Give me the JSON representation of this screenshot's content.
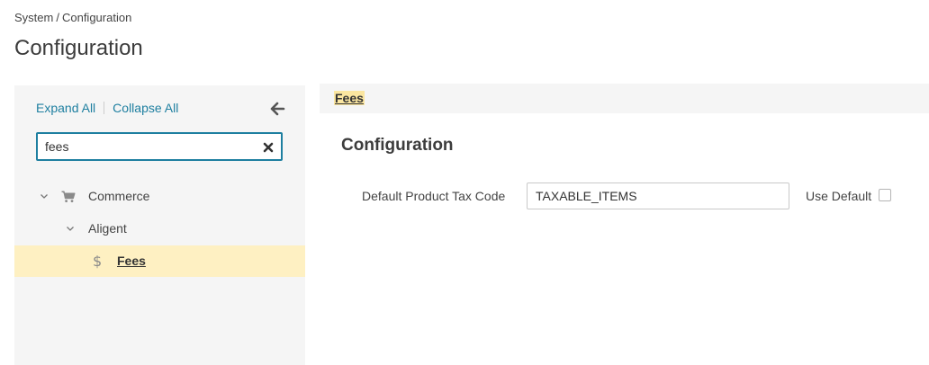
{
  "breadcrumb": {
    "parent": "System",
    "separator": "/",
    "current": "Configuration"
  },
  "page_title": "Configuration",
  "sidebar": {
    "expand_all": "Expand All",
    "collapse_all": "Collapse All",
    "search": {
      "value": "fees",
      "placeholder": ""
    },
    "tree": [
      {
        "label": "Commerce",
        "icon": "cart-icon",
        "expanded": true
      },
      {
        "label": "Aligent",
        "icon": "",
        "expanded": true
      },
      {
        "label": "Fees",
        "icon": "dollar-icon",
        "selected": true
      }
    ]
  },
  "content": {
    "header_crumb": "Fees",
    "section_title": "Configuration",
    "field": {
      "label": "Default Product Tax Code",
      "value": "TAXABLE_ITEMS",
      "use_default_label": "Use Default",
      "use_default_checked": false
    }
  },
  "colors": {
    "link": "#1e7fa0",
    "selected_bg": "#fef0c2",
    "panel_bg": "#f5f5f5"
  }
}
